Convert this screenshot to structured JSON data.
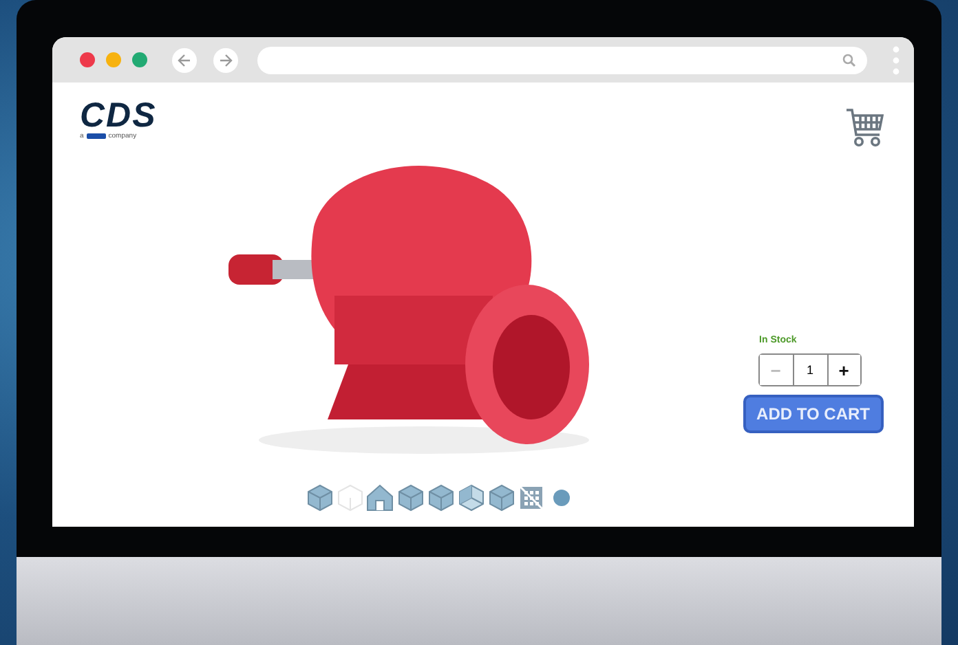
{
  "logo": {
    "wordmark": "CDS",
    "prefix": "a",
    "suffix": "company"
  },
  "product": {
    "stock": "In Stock",
    "quantity": {
      "minus": "−",
      "value": "1",
      "plus": "+",
      "minus_disabled": true
    },
    "add_button": "ADD TO CART"
  },
  "view_controls": [
    {
      "kind": "cube"
    },
    {
      "kind": "faint"
    },
    {
      "kind": "house"
    },
    {
      "kind": "cube"
    },
    {
      "kind": "cube"
    },
    {
      "kind": "open"
    },
    {
      "kind": "cube"
    },
    {
      "kind": "grid"
    },
    {
      "kind": "dot"
    }
  ]
}
